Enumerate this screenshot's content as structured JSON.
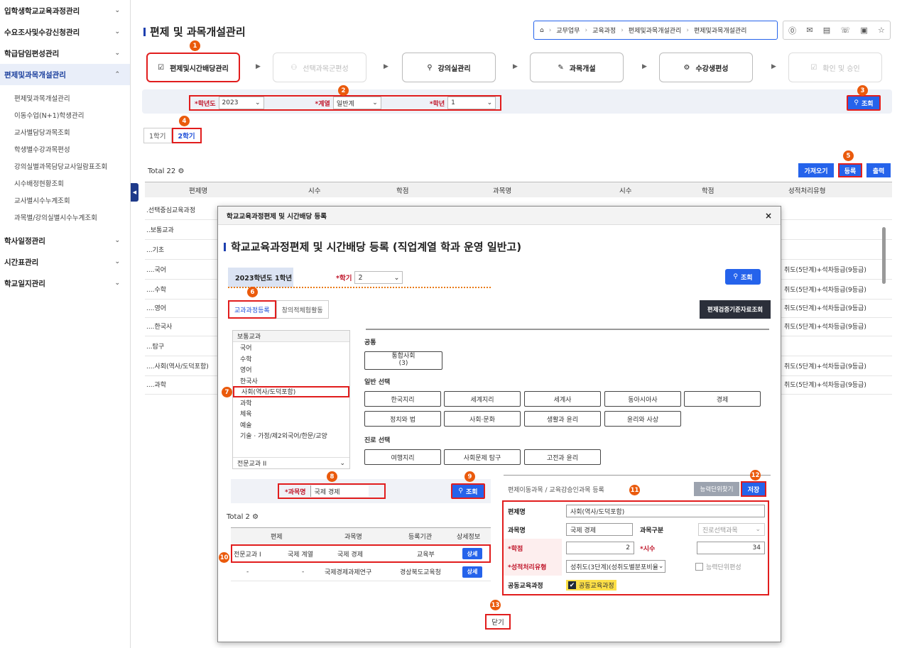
{
  "sidebar": {
    "menus": [
      {
        "label": "입학생학교교육과정관리"
      },
      {
        "label": "수요조사및수강신청관리"
      },
      {
        "label": "학급담임편성관리"
      },
      {
        "label": "편제및과목개설관리"
      }
    ],
    "subs": [
      "편제및과목개설관리",
      "이동수업(N+1)학생관리",
      "교사별담당과목조회",
      "학생별수강과목편성",
      "강의실별과목담당교사일람표조회",
      "시수배정현황조회",
      "교사별시수누계조회",
      "과목별/강의실별시수누계조회"
    ],
    "menus2": [
      {
        "label": "학사일정관리"
      },
      {
        "label": "시간표관리"
      },
      {
        "label": "학교일지관리"
      }
    ]
  },
  "header": {
    "title": "편제 및 과목개설관리",
    "breadcrumb": [
      "교무업무",
      "교육과정",
      "편제및과목개설관리",
      "편제및과목개설관리"
    ]
  },
  "steps": [
    "편제및시간배당관리",
    "선택과목군편성",
    "강의실관리",
    "과목개설",
    "수강생편성",
    "확인 및 승인"
  ],
  "filter": {
    "year_label": "*학년도",
    "year": "2023",
    "track_label": "*계열",
    "track": "일반계",
    "grade_label": "*학년",
    "grade": "1",
    "search": "조회"
  },
  "semesters": [
    "1학기",
    "2학기"
  ],
  "grid": {
    "total": "Total 22",
    "buttons": {
      "import": "가져오기",
      "register": "등록",
      "print": "출력"
    },
    "headers": [
      "편제명",
      "시수",
      "학점",
      "과목명",
      "시수",
      "학점",
      "성적처리유형"
    ],
    "rows": [
      {
        "name": ".선택중심교육과정",
        "type": ""
      },
      {
        "name": "..보통교과",
        "type": ""
      },
      {
        "name": "...기초",
        "type": ""
      },
      {
        "name": "....국어",
        "type": "취도(5단계)+석차등급(9등급)"
      },
      {
        "name": "....수학",
        "type": "취도(5단계)+석차등급(9등급)"
      },
      {
        "name": "....영어",
        "type": "취도(5단계)+석차등급(9등급)"
      },
      {
        "name": "....한국사",
        "type": "취도(5단계)+석차등급(9등급)"
      },
      {
        "name": "...탐구",
        "type": ""
      },
      {
        "name": "....사회(역사/도덕포함)",
        "type": "취도(5단계)+석차등급(9등급)"
      },
      {
        "name": "....과학",
        "type": "취도(5단계)+석차등급(9등급)"
      }
    ]
  },
  "modal": {
    "header": "학교교육과정편제 및 시간배당 등록",
    "title": "학교교육과정편제 및 시간배당 등록 (직업계열 학과 운영 일반고)",
    "year_grade": "2023학년도 1학년",
    "semester_label": "*학기",
    "semester": "2",
    "search": "조회",
    "tabs": [
      "교과과정등록",
      "창의적체험활동"
    ],
    "standard_btn": "편제검증기준자료조회",
    "subject_list": {
      "header": "보통교과",
      "items": [
        "국어",
        "수학",
        "영어",
        "한국사",
        "사회(역사/도덕포함)",
        "과학",
        "체육",
        "예술",
        "기술 · 가정/제2외국어/한문/교양"
      ],
      "footer": "전문교과 II"
    },
    "groups": {
      "common": "공통",
      "common_items": [
        "통합사회"
      ],
      "common_sub": "(3)",
      "general": "일반 선택",
      "general_items": [
        "한국지리",
        "세계지리",
        "세계사",
        "동아시아사",
        "경제",
        "정치와 법",
        "사회·문화",
        "생활과 윤리",
        "윤리와 사상"
      ],
      "career": "진로 선택",
      "career_items": [
        "여행지리",
        "사회문제 탐구",
        "고전과 윤리"
      ]
    },
    "course_search": {
      "label": "*과목명",
      "value": "국제 경제",
      "button": "조회"
    },
    "results": {
      "total": "Total 2",
      "headers": [
        "편제",
        "과목명",
        "등록기관",
        "상세정보"
      ],
      "rows": [
        {
          "c1": "전문교과 I",
          "c2": "국제 계열",
          "c3": "국제 경제",
          "c4": "교육부",
          "btn": "상세"
        },
        {
          "c1": "-",
          "c2": "-",
          "c3": "국제경제과제연구",
          "c4": "경상북도교육청",
          "btn": "상세"
        }
      ]
    },
    "panel": {
      "title": "편제이동과목 / 교육감승인과목 등록",
      "find_btn": "능력단위찾기",
      "save_btn": "저장",
      "f_name_label": "편제명",
      "f_name": "사회(역사/도덕포함)",
      "f_subject_label": "과목명",
      "f_subject": "국제 경제",
      "f_kind_label": "과목구분",
      "f_kind": "진로선택과목",
      "f_credit_label": "*학점",
      "f_credit": "2",
      "f_hours_label": "*시수",
      "f_hours": "34",
      "f_grade_label": "*성적처리유형",
      "f_grade": "성취도(3단계)(성취도별분포비율",
      "f_unit": "능력단위편성",
      "f_common_label": "공동교육과정",
      "f_common": "공동교육과정"
    },
    "close": "닫기"
  },
  "badges": [
    "1",
    "2",
    "3",
    "4",
    "5",
    "6",
    "7",
    "8",
    "9",
    "10",
    "11",
    "12",
    "13"
  ],
  "colors": {
    "primary": "#2563eb",
    "highlight": "#e11d1d",
    "badge": "#ea5a0c"
  }
}
